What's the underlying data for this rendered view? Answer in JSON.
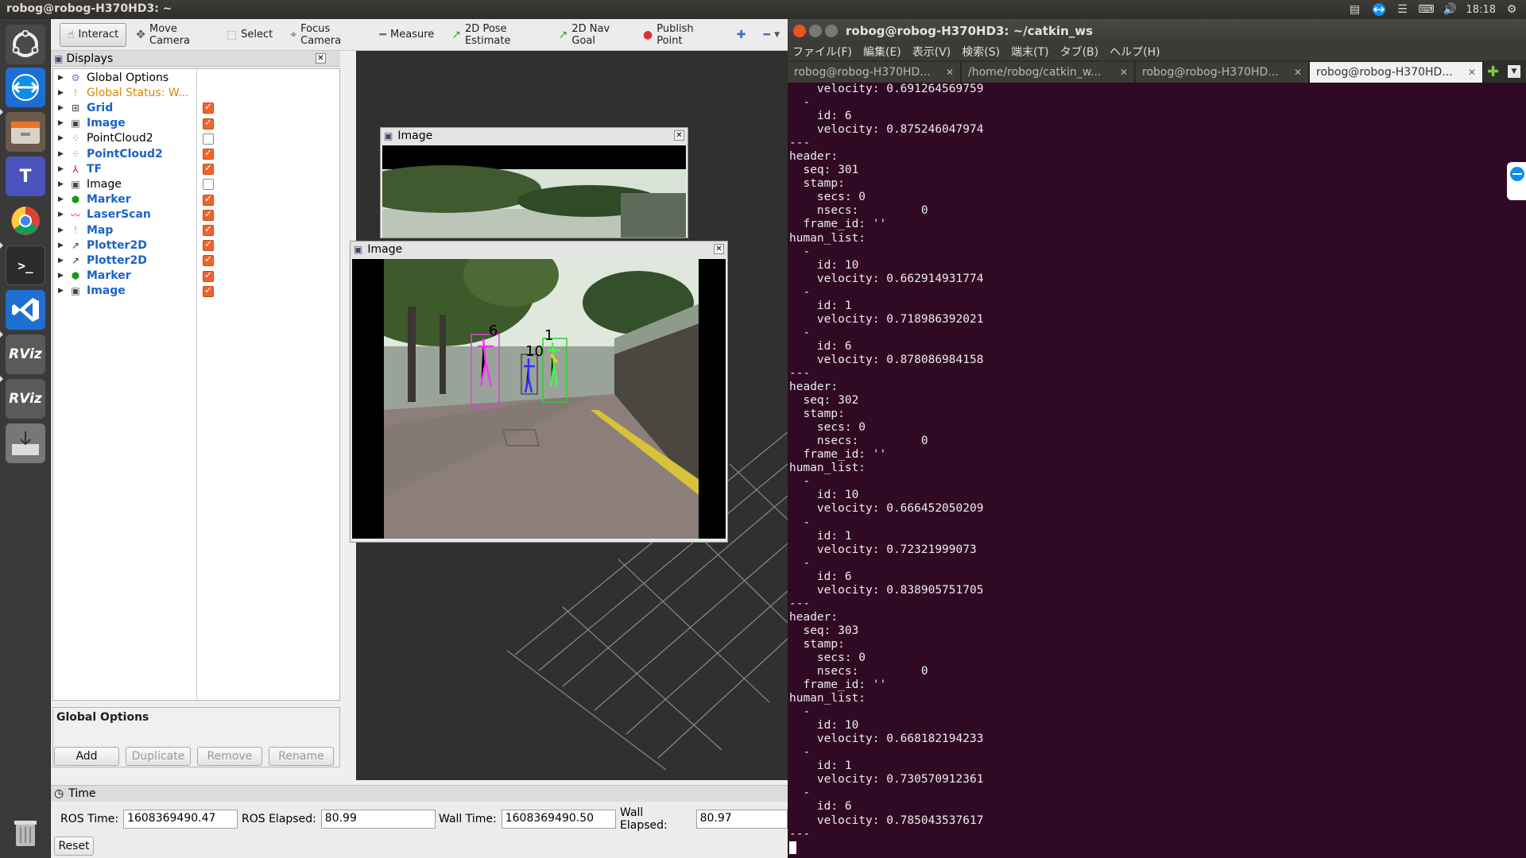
{
  "topbar": {
    "title": "robog@robog-H370HD3: ~",
    "clock": "18:18"
  },
  "launcher": {
    "items": [
      {
        "name": "ubuntu-dash-icon",
        "label": ""
      },
      {
        "name": "teamviewer-icon",
        "label": ""
      },
      {
        "name": "files-icon",
        "label": ""
      },
      {
        "name": "teams-icon",
        "label": "T"
      },
      {
        "name": "chrome-icon",
        "label": ""
      },
      {
        "name": "terminal-icon",
        "label": ">_"
      },
      {
        "name": "vscode-icon",
        "label": ""
      },
      {
        "name": "rviz-icon-1",
        "label": "RViz"
      },
      {
        "name": "rviz-icon-2",
        "label": "RViz"
      },
      {
        "name": "installer-icon",
        "label": ""
      },
      {
        "name": "trash-icon",
        "label": ""
      }
    ]
  },
  "rviz": {
    "toolbar": [
      {
        "name": "interact-tool",
        "icon": "☝",
        "label": "Interact",
        "active": true
      },
      {
        "name": "move-camera-tool",
        "icon": "✥",
        "label": "Move Camera",
        "active": false
      },
      {
        "name": "select-tool",
        "icon": "⬚",
        "label": "Select",
        "active": false
      },
      {
        "name": "focus-camera-tool",
        "icon": "⌖",
        "label": "Focus Camera",
        "active": false
      },
      {
        "name": "measure-tool",
        "icon": "━",
        "label": "Measure",
        "active": false
      },
      {
        "name": "pose-estimate-tool",
        "icon": "↗",
        "label": "2D Pose Estimate",
        "active": false
      },
      {
        "name": "nav-goal-tool",
        "icon": "↗",
        "label": "2D Nav Goal",
        "active": false
      },
      {
        "name": "publish-point-tool",
        "icon": "📍",
        "label": "Publish Point",
        "active": false
      },
      {
        "name": "add-tool",
        "icon": "✚",
        "label": "",
        "active": false
      },
      {
        "name": "remove-tool",
        "icon": "━",
        "label": "",
        "active": false
      }
    ],
    "displays_title": "Displays",
    "displays": [
      {
        "label": "Global Options",
        "style": "",
        "icon": "⚙",
        "icolor": "#5c7fb8",
        "checked": null
      },
      {
        "label": "Global Status: W...",
        "style": "orange",
        "icon": "!",
        "icolor": "#f0a020",
        "checked": null
      },
      {
        "label": "Grid",
        "style": "blue",
        "icon": "⊞",
        "icolor": "#444",
        "checked": true
      },
      {
        "label": "Image",
        "style": "blue",
        "icon": "▣",
        "icolor": "#445",
        "checked": true
      },
      {
        "label": "PointCloud2",
        "style": "",
        "icon": "⁘",
        "icolor": "#3a7bd5",
        "checked": false
      },
      {
        "label": "PointCloud2",
        "style": "blue",
        "icon": "⁘",
        "icolor": "#3a7bd5",
        "checked": true
      },
      {
        "label": "TF",
        "style": "blue",
        "icon": "⅄",
        "icolor": "#c04",
        "checked": true
      },
      {
        "label": "Image",
        "style": "",
        "icon": "▣",
        "icolor": "#445",
        "checked": false
      },
      {
        "label": "Marker",
        "style": "blue",
        "icon": "⬢",
        "icolor": "#1a9a1a",
        "checked": true
      },
      {
        "label": "LaserScan",
        "style": "blue",
        "icon": "〰",
        "icolor": "#d0202a",
        "checked": true
      },
      {
        "label": "Map",
        "style": "blue",
        "icon": "!",
        "icolor": "#f0a020",
        "checked": true
      },
      {
        "label": "Plotter2D",
        "style": "blue",
        "icon": "↗",
        "icolor": "#333",
        "checked": true
      },
      {
        "label": "Plotter2D",
        "style": "blue",
        "icon": "↗",
        "icolor": "#333",
        "checked": true
      },
      {
        "label": "Marker",
        "style": "blue",
        "icon": "⬢",
        "icolor": "#1a9a1a",
        "checked": true
      },
      {
        "label": "Image",
        "style": "blue",
        "icon": "▣",
        "icolor": "#445",
        "checked": true
      }
    ],
    "props_title": "Global Options",
    "buttons": {
      "add": "Add",
      "duplicate": "Duplicate",
      "remove": "Remove",
      "rename": "Rename"
    },
    "time": {
      "title": "Time",
      "ros_time_label": "ROS Time:",
      "ros_time": "1608369490.47",
      "ros_elapsed_label": "ROS Elapsed:",
      "ros_elapsed": "80.99",
      "wall_time_label": "Wall Time:",
      "wall_time": "1608369490.50",
      "wall_elapsed_label": "Wall Elapsed:",
      "wall_elapsed": "80.97",
      "reset": "Reset"
    },
    "image_window_back": {
      "title": "Image"
    },
    "image_window_front": {
      "title": "Image",
      "labels": [
        "6",
        "10",
        "1"
      ]
    }
  },
  "terminal": {
    "title": "robog@robog-H370HD3: ~/catkin_ws",
    "menu": [
      "ファイル(F)",
      "編集(E)",
      "表示(V)",
      "検索(S)",
      "端末(T)",
      "タブ(B)",
      "ヘルプ(H)"
    ],
    "tabs": [
      "robog@robog-H370HD...",
      "/home/robog/catkin_w...",
      "robog@robog-H370HD...",
      "robog@robog-H370HD..."
    ],
    "output": "    velocity: 0.691264569759\n  -\n    id: 6\n    velocity: 0.875246047974\n---\nheader:\n  seq: 301\n  stamp:\n    secs: 0\n    nsecs:         0\n  frame_id: ''\nhuman_list:\n  -\n    id: 10\n    velocity: 0.662914931774\n  -\n    id: 1\n    velocity: 0.718986392021\n  -\n    id: 6\n    velocity: 0.878086984158\n---\nheader:\n  seq: 302\n  stamp:\n    secs: 0\n    nsecs:         0\n  frame_id: ''\nhuman_list:\n  -\n    id: 10\n    velocity: 0.666452050209\n  -\n    id: 1\n    velocity: 0.72321999073\n  -\n    id: 6\n    velocity: 0.838905751705\n---\nheader:\n  seq: 303\n  stamp:\n    secs: 0\n    nsecs:         0\n  frame_id: ''\nhuman_list:\n  -\n    id: 10\n    velocity: 0.668182194233\n  -\n    id: 1\n    velocity: 0.730570912361\n  -\n    id: 6\n    velocity: 0.785043537617\n---"
  }
}
